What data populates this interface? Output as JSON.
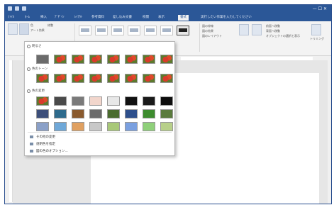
{
  "window": {
    "title": "",
    "context_tab": "",
    "controls_glyph": "— ☐ ✕"
  },
  "tabs": [
    {
      "label": "ﾌｧｲﾙ"
    },
    {
      "label": "ﾎｰﾑ"
    },
    {
      "label": "挿入"
    },
    {
      "label": "ﾃﾞｻﾞｲﾝ"
    },
    {
      "label": "ﾚｲｱｳﾄ"
    },
    {
      "label": "参考資料"
    },
    {
      "label": "差し込み文書"
    },
    {
      "label": "校閲"
    },
    {
      "label": "表示"
    },
    {
      "label": "書式"
    }
  ],
  "tab_search": "実行したい作業を入力してください",
  "ribbon": {
    "adjust_labels": [
      "修整",
      "色",
      "アート効果"
    ],
    "style_count": 7,
    "arrange_labels": [
      "図の枠線",
      "図の効果",
      "図のレイアウト"
    ],
    "order_labels": [
      "前面へ移動",
      "背面へ移動",
      "オブジェクトの選択と表示"
    ],
    "size_label": "トリミング"
  },
  "dropdown": {
    "sections": [
      {
        "label": "明るさ"
      },
      {
        "label": "色のトーン"
      },
      {
        "label": "色の変更"
      }
    ],
    "menu_items": [
      {
        "label": "その他の変更"
      },
      {
        "label": "透明色を指定"
      },
      {
        "label": "図の色のオプション..."
      }
    ]
  },
  "colors": {
    "titlebar": "#2b5797",
    "ribbon": "#f3f3f3",
    "workspace": "#e6e6e6"
  }
}
